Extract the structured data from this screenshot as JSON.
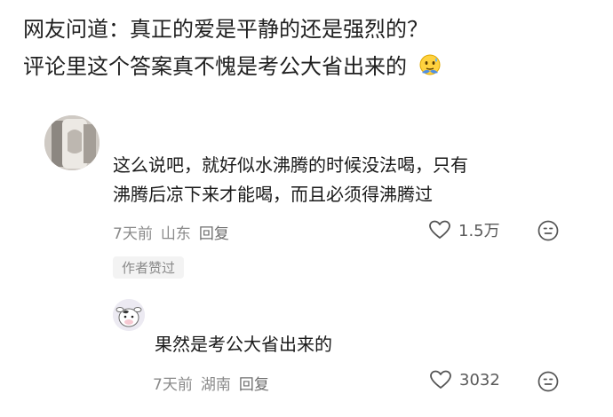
{
  "post": {
    "line1": "网友问道：真正的爱是平静的还是强烈的？",
    "line2": "评论里这个答案真不愧是考公大省出来的",
    "line2_emoji": "sweating-hug-emoji"
  },
  "comments": [
    {
      "avatar": "avatar-photo",
      "text_line1": "这么说吧，就好似水沸腾的时候没法喝，只有",
      "text_line2": "沸腾后凉下来才能喝，而且必须得沸腾过",
      "time": "7天前",
      "location": "山东",
      "reply_label": "回复",
      "likes": "1.5万",
      "author_liked": "作者赞过"
    },
    {
      "avatar": "avatar-cow",
      "text": "果然是考公大省出来的",
      "time": "7天前",
      "location": "湖南",
      "reply_label": "回复",
      "likes": "3032"
    }
  ],
  "icons": {
    "like": "heart-outline-icon",
    "dislike": "unhappy-face-icon"
  },
  "colors": {
    "text": "#1a1a1a",
    "meta": "#8a8a8a",
    "badge_bg": "#f3f3f3"
  }
}
